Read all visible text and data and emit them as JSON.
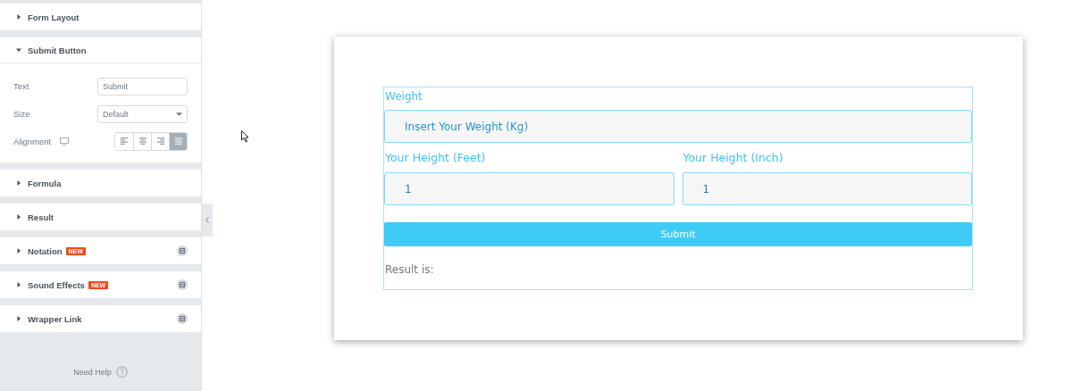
{
  "sidebar": {
    "sections": [
      {
        "title": "Form Layout",
        "expanded": false,
        "pro": false
      },
      {
        "title": "Submit Button",
        "expanded": true,
        "pro": false,
        "controls": [
          {
            "kind": "text",
            "label": "Text",
            "value": "Submit"
          },
          {
            "kind": "select",
            "label": "Size",
            "value": "Default"
          },
          {
            "kind": "align",
            "label": "Alignment",
            "options": [
              {
                "kind": "left",
                "selected": false
              },
              {
                "kind": "center",
                "selected": false
              },
              {
                "kind": "right",
                "selected": false
              },
              {
                "kind": "justify",
                "selected": true
              }
            ]
          }
        ]
      },
      {
        "title": "Formula",
        "expanded": false,
        "pro": false
      },
      {
        "title": "Result",
        "expanded": false,
        "pro": false
      },
      {
        "title": "Notation",
        "expanded": false,
        "badge": "NEW",
        "pro": true
      },
      {
        "title": "Sound Effects",
        "expanded": false,
        "badge": "NEW",
        "pro": true
      },
      {
        "title": "Wrapper Link",
        "expanded": false,
        "pro": true
      }
    ],
    "help": "Need Help"
  },
  "preview": {
    "weight_label": "Weight",
    "weight_placeholder": "Insert Your Weight (Kg)",
    "height_fields": [
      {
        "label": "Your Height (Feet)",
        "value": "1"
      },
      {
        "label": "Your Height (Inch)",
        "value": "1"
      }
    ],
    "submit": "Submit",
    "result": "Result is:"
  }
}
